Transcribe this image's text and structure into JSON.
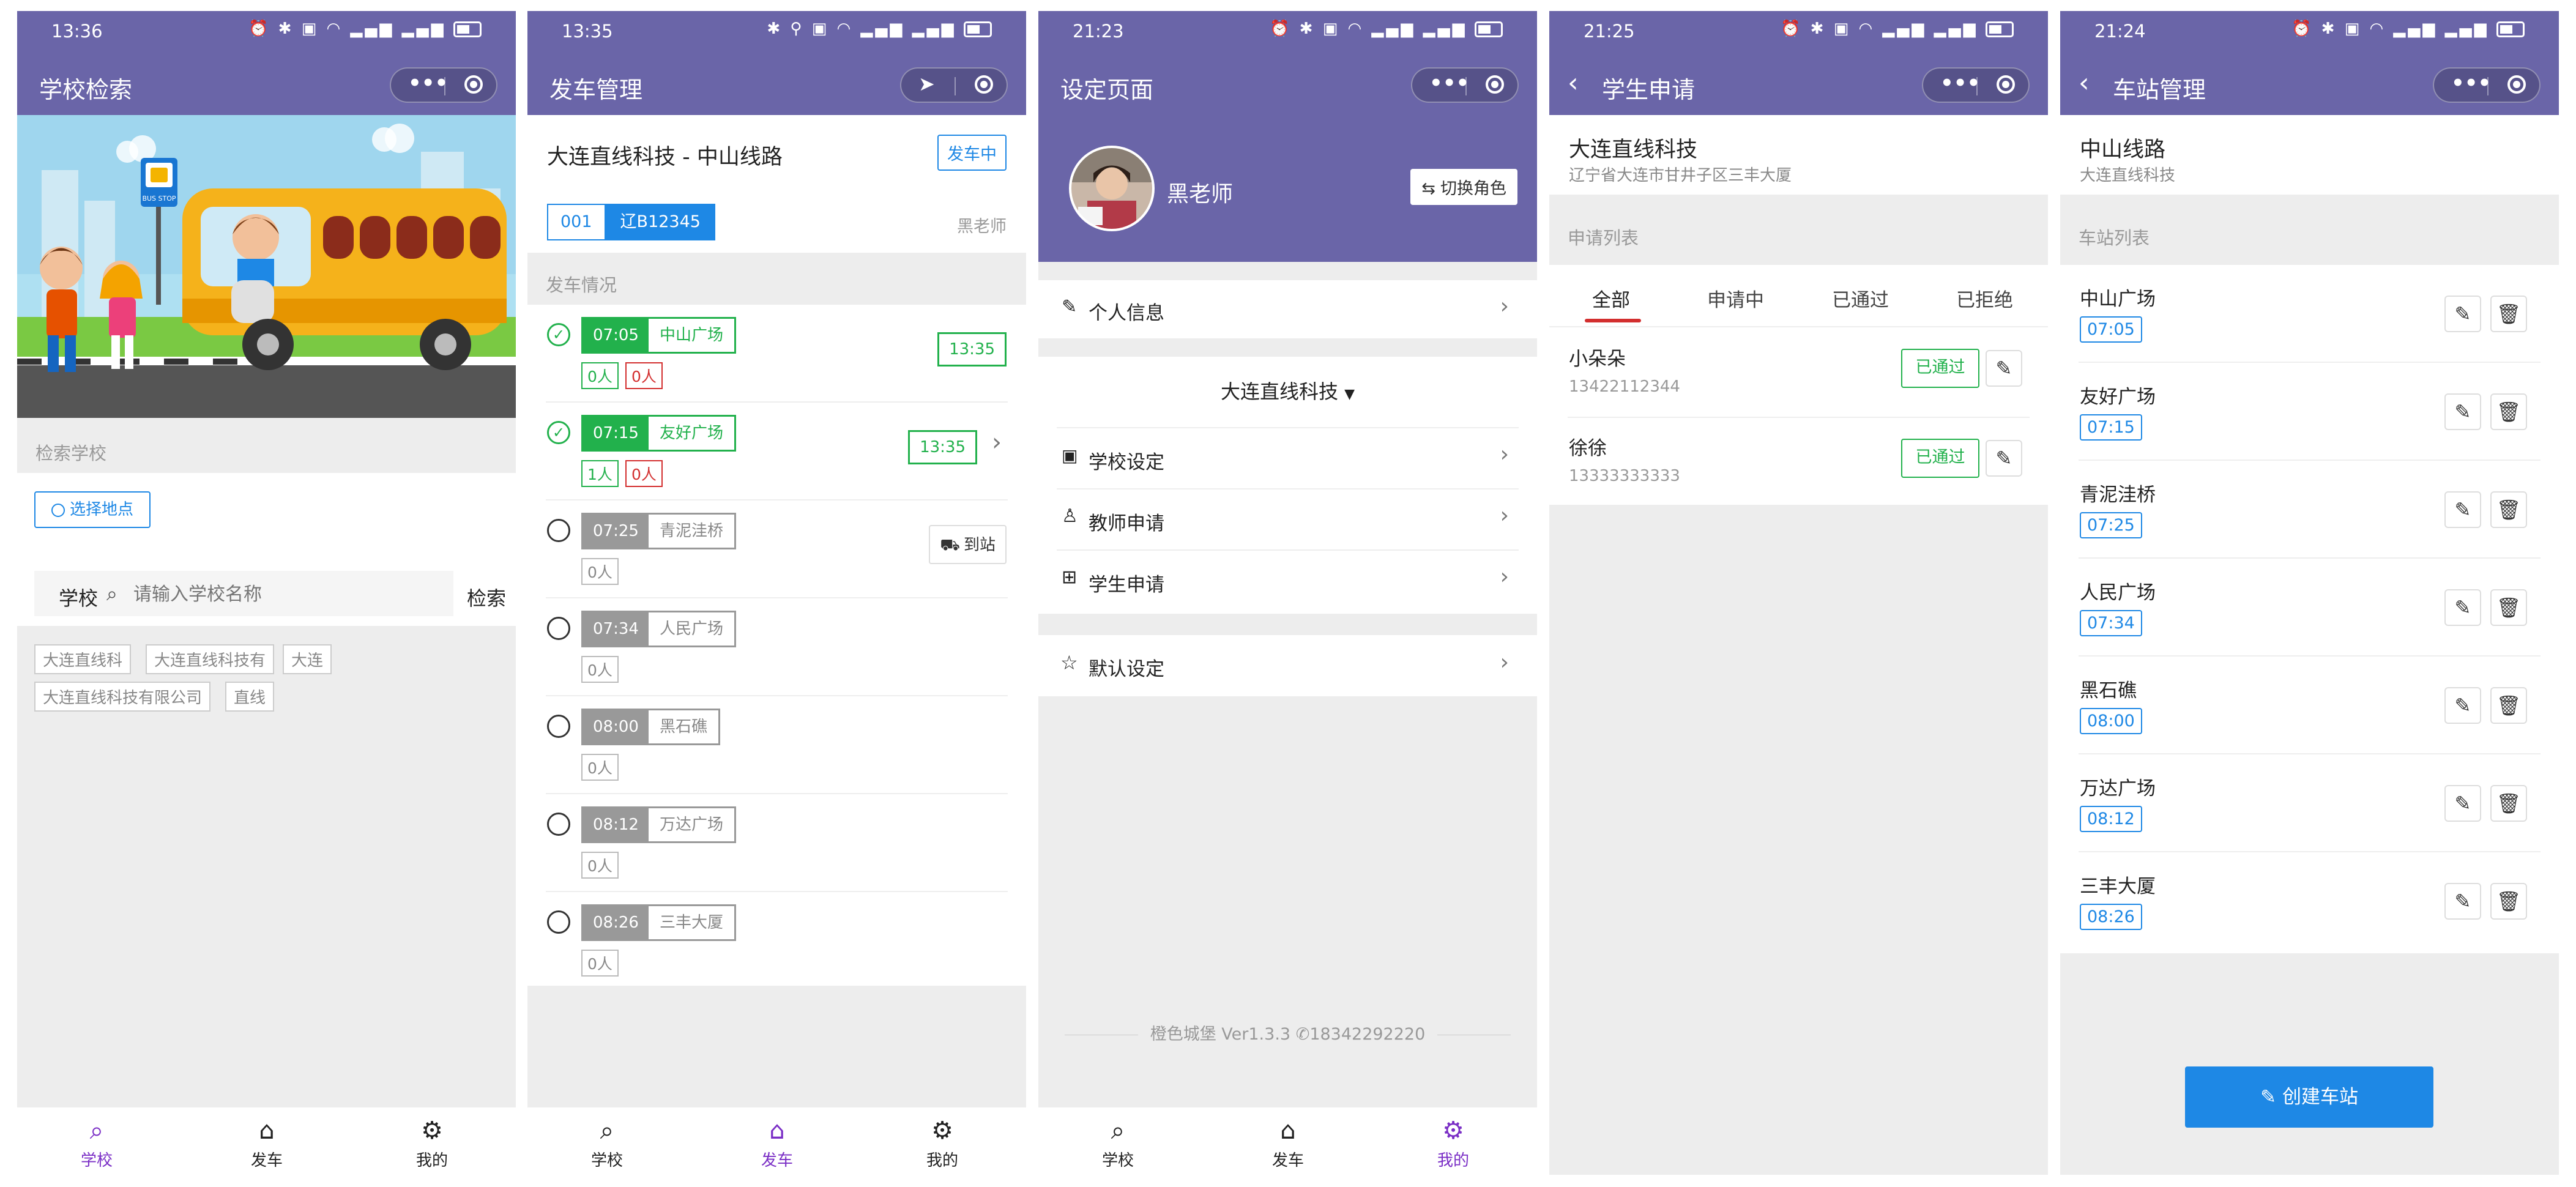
{
  "tabs": [
    {
      "label": "学校",
      "icon": "search-icon"
    },
    {
      "label": "发车",
      "icon": "home-icon"
    },
    {
      "label": "我的",
      "icon": "gear-icon"
    }
  ],
  "screen1": {
    "time": "13:36",
    "title": "学校检索",
    "section_label": "检索学校",
    "select_location": "选择地点",
    "search_label": "学校",
    "search_placeholder": "请输入学校名称",
    "search_button": "检索",
    "tags": [
      "大连直线科",
      "大连直线科技有",
      "大连",
      "大连直线科技有限公司",
      "直线"
    ],
    "banner_sign": "BUS STOP",
    "active_tab": 0
  },
  "screen2": {
    "time": "13:35",
    "title": "发车管理",
    "route_name": "大连直线科技 - 中山线路",
    "status_button": "发车中",
    "bus_no": "001",
    "plate": "辽B12345",
    "teacher": "黑老师",
    "section_label": "发车情况",
    "arrive_label": "到站",
    "stops": [
      {
        "time": "07:05",
        "name": "中山广场",
        "done": true,
        "count": "0人",
        "count2": "0人",
        "arrival": "13:35"
      },
      {
        "time": "07:15",
        "name": "友好广场",
        "done": true,
        "count": "1人",
        "count2": "0人",
        "arrival": "13:35"
      },
      {
        "time": "07:25",
        "name": "青泥洼桥",
        "done": false,
        "count": "0人"
      },
      {
        "time": "07:34",
        "name": "人民广场",
        "done": false,
        "count": "0人"
      },
      {
        "time": "08:00",
        "name": "黑石礁",
        "done": false,
        "count": "0人"
      },
      {
        "time": "08:12",
        "name": "万达广场",
        "done": false,
        "count": "0人"
      },
      {
        "time": "08:26",
        "name": "三丰大厦",
        "done": false,
        "count": "0人"
      }
    ],
    "active_tab": 1
  },
  "screen3": {
    "time": "21:23",
    "title": "设定页面",
    "user_name": "黑老师",
    "switch_role": "切换角色",
    "personal_info": "个人信息",
    "company": "大连直线科技",
    "school_settings": "学校设定",
    "teacher_apply": "教师申请",
    "student_apply": "学生申请",
    "default_settings": "默认设定",
    "footer_brand": "橙色城堡",
    "footer_version": "Ver1.3.3",
    "footer_phone": "18342292220",
    "active_tab": 2
  },
  "screen4": {
    "time": "21:25",
    "title": "学生申请",
    "company": "大连直线科技",
    "address": "辽宁省大连市甘井子区三丰大厦",
    "section_label": "申请列表",
    "tabs": [
      "全部",
      "申请中",
      "已通过",
      "已拒绝"
    ],
    "items": [
      {
        "name": "小朵朵",
        "phone": "13422112344",
        "status": "已通过"
      },
      {
        "name": "徐徐",
        "phone": "13333333333",
        "status": "已通过"
      }
    ]
  },
  "screen5": {
    "time": "21:24",
    "title": "车站管理",
    "route": "中山线路",
    "company": "大连直线科技",
    "section_label": "车站列表",
    "stations": [
      {
        "name": "中山广场",
        "time": "07:05"
      },
      {
        "name": "友好广场",
        "time": "07:15"
      },
      {
        "name": "青泥洼桥",
        "time": "07:25"
      },
      {
        "name": "人民广场",
        "time": "07:34"
      },
      {
        "name": "黑石礁",
        "time": "08:00"
      },
      {
        "name": "万达广场",
        "time": "08:12"
      },
      {
        "name": "三丰大厦",
        "time": "08:26"
      }
    ],
    "create_button": "创建车站"
  },
  "colors": {
    "header": "#6a65a8",
    "accent_purple": "#7b2fc6",
    "green": "#22b14c",
    "blue": "#1e88e5",
    "red": "#d32f2f",
    "tab_underline": "#d32f2f"
  }
}
